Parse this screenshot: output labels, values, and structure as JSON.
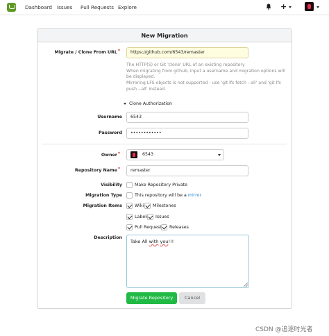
{
  "nav": {
    "items": [
      "Dashboard",
      "Issues",
      "Pull Requests",
      "Explore"
    ],
    "plus_label": "+"
  },
  "form": {
    "title": "New Migration",
    "clone_url": {
      "label": "Migrate / Clone From URL",
      "value": "https://github.com/6543/remaster",
      "help": [
        "The HTTP(S) or Git 'clone' URL of an existing repository",
        "When migrating from github, input a username and migration options will be displayed.",
        "Mirroring LFS objects is not supported - use 'git lfs fetch --all' and 'git lfs push --all' instead."
      ]
    },
    "clone_auth": {
      "label": "Clone Authorization"
    },
    "username": {
      "label": "Username",
      "value": "6543"
    },
    "password": {
      "label": "Password",
      "value": "••••••••••••"
    },
    "owner": {
      "label": "Owner",
      "value": "6543"
    },
    "repo_name": {
      "label": "Repository Name",
      "value": "remaster"
    },
    "visibility": {
      "label": "Visibility",
      "option": "Make Repository Private",
      "checked": false
    },
    "migration_type": {
      "label": "Migration Type",
      "text": "This repository will be a",
      "link": "mirror",
      "checked": false
    },
    "migration_items": {
      "label": "Migration Items",
      "items": [
        {
          "label": "Wiki",
          "checked": true
        },
        {
          "label": "Milestones",
          "checked": true
        },
        {
          "label": "Labels",
          "checked": true
        },
        {
          "label": "Issues",
          "checked": true
        },
        {
          "label": "Pull Requests",
          "checked": true
        },
        {
          "label": "Releases",
          "checked": true
        }
      ]
    },
    "description": {
      "label": "Description",
      "value_parts": [
        "Take All ",
        "with",
        " ",
        "you",
        "!!!"
      ]
    },
    "buttons": {
      "submit": "Migrate Repository",
      "cancel": "Cancel"
    }
  },
  "watermark": "CSDN @追逐时光者",
  "colors": {
    "primary": "#21ba45",
    "link": "#2185d0",
    "logo": "#609926",
    "url_field_bg": "#fffde0"
  }
}
